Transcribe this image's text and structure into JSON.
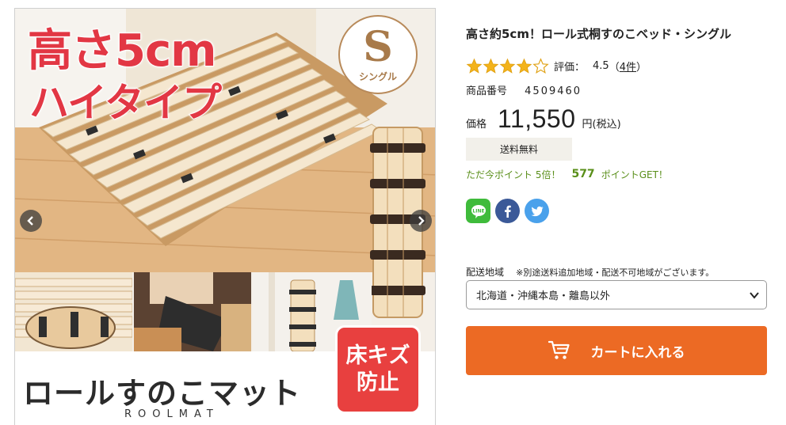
{
  "gallery": {
    "promo_line1": "高さ5cm",
    "promo_line2": "ハイタイプ",
    "size_letter": "S",
    "size_label": "シングル",
    "banner_title": "ロールすのこマット",
    "banner_subtitle": "ROOLMAT",
    "floor_badge_line1": "床キズ",
    "floor_badge_line2": "防止",
    "prev_icon": "chevron-left-icon",
    "next_icon": "chevron-right-icon"
  },
  "product": {
    "title": "高さ約5cm！ロール式桐すのこベッド・シングル",
    "rating": {
      "stars": 4,
      "max_stars": 5,
      "label": "評価：",
      "score": "4.5",
      "count_open": "（",
      "count": "4件",
      "count_close": "）"
    },
    "sku_label": "商品番号",
    "sku_value": "4509460",
    "price_label": "価格",
    "price_value": "11,550",
    "price_unit": "円(税込)",
    "shipping": "送料無料",
    "points_prefix": "ただ今ポイント 5倍！",
    "points_value": "577",
    "points_suffix": "ポイントGET！",
    "share_icons": [
      "line-icon",
      "facebook-icon",
      "twitter-icon"
    ]
  },
  "order": {
    "region_label": "配送地域",
    "region_note": "※別途送料追加地域・配送不可地域がございます。",
    "region_selected": "北海道・沖縄本島・離島以外",
    "cart_label": "カートに入れる"
  },
  "colors": {
    "accent_orange": "#ec6a24",
    "points_green": "#5a8f1a",
    "star_gold": "#f3b31b",
    "promo_red": "#e23744"
  }
}
